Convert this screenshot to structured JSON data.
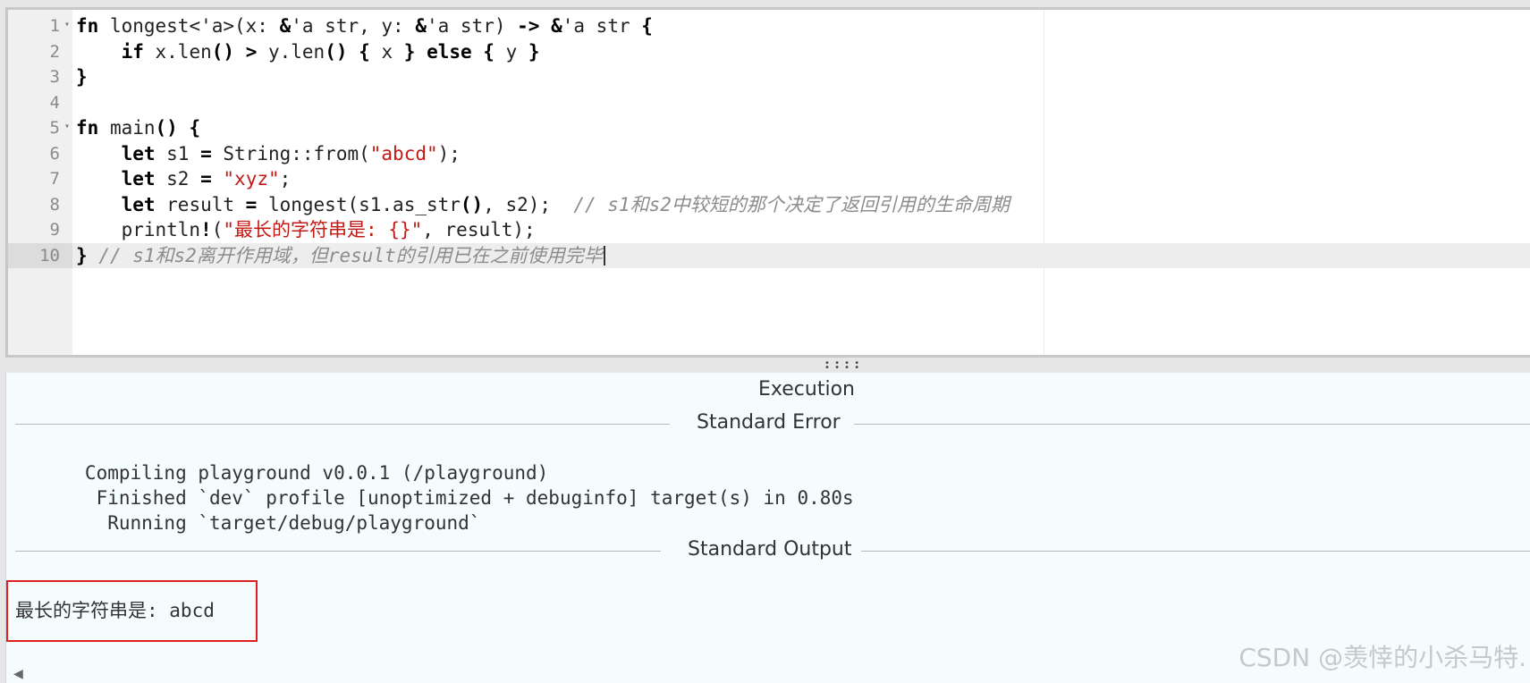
{
  "editor": {
    "lines": [
      {
        "num": "1",
        "fold": "▾",
        "tokens": [
          {
            "t": "fn",
            "c": "k"
          },
          {
            "t": " longest<'a>(x: "
          },
          {
            "t": "&",
            "c": "k"
          },
          {
            "t": "'a str, y: "
          },
          {
            "t": "&",
            "c": "k"
          },
          {
            "t": "'a str) "
          },
          {
            "t": "->",
            "c": "k"
          },
          {
            "t": " "
          },
          {
            "t": "&",
            "c": "k"
          },
          {
            "t": "'a str "
          },
          {
            "t": "{",
            "c": "k"
          }
        ]
      },
      {
        "num": "2",
        "fold": "",
        "tokens": [
          {
            "t": "    "
          },
          {
            "t": "if",
            "c": "k"
          },
          {
            "t": " x.len"
          },
          {
            "t": "()",
            "c": "k"
          },
          {
            "t": " "
          },
          {
            "t": ">",
            "c": "k"
          },
          {
            "t": " y.len"
          },
          {
            "t": "()",
            "c": "k"
          },
          {
            "t": " "
          },
          {
            "t": "{",
            "c": "k"
          },
          {
            "t": " x "
          },
          {
            "t": "}",
            "c": "k"
          },
          {
            "t": " "
          },
          {
            "t": "else",
            "c": "k"
          },
          {
            "t": " "
          },
          {
            "t": "{",
            "c": "k"
          },
          {
            "t": " y "
          },
          {
            "t": "}",
            "c": "k"
          }
        ]
      },
      {
        "num": "3",
        "fold": "",
        "tokens": [
          {
            "t": "}",
            "c": "k"
          }
        ]
      },
      {
        "num": "4",
        "fold": "",
        "tokens": []
      },
      {
        "num": "5",
        "fold": "▾",
        "tokens": [
          {
            "t": "fn",
            "c": "k"
          },
          {
            "t": " main"
          },
          {
            "t": "()",
            "c": "k"
          },
          {
            "t": " "
          },
          {
            "t": "{",
            "c": "k"
          }
        ]
      },
      {
        "num": "6",
        "fold": "",
        "tokens": [
          {
            "t": "    "
          },
          {
            "t": "let",
            "c": "k"
          },
          {
            "t": " s1 "
          },
          {
            "t": "=",
            "c": "k"
          },
          {
            "t": " String::from("
          },
          {
            "t": "\"abcd\"",
            "c": "s"
          },
          {
            "t": ");"
          }
        ]
      },
      {
        "num": "7",
        "fold": "",
        "tokens": [
          {
            "t": "    "
          },
          {
            "t": "let",
            "c": "k"
          },
          {
            "t": " s2 "
          },
          {
            "t": "=",
            "c": "k"
          },
          {
            "t": " "
          },
          {
            "t": "\"xyz\"",
            "c": "s"
          },
          {
            "t": ";"
          }
        ]
      },
      {
        "num": "8",
        "fold": "",
        "tokens": [
          {
            "t": "    "
          },
          {
            "t": "let",
            "c": "k"
          },
          {
            "t": " result "
          },
          {
            "t": "=",
            "c": "k"
          },
          {
            "t": " longest(s1.as_str"
          },
          {
            "t": "()",
            "c": "k"
          },
          {
            "t": ", s2);  "
          },
          {
            "t": "// s1和s2中较短的那个决定了返回引用的生命周期",
            "c": "c"
          }
        ]
      },
      {
        "num": "9",
        "fold": "",
        "tokens": [
          {
            "t": "    println"
          },
          {
            "t": "!",
            "c": "k"
          },
          {
            "t": "("
          },
          {
            "t": "\"最长的字符串是: {}\"",
            "c": "s"
          },
          {
            "t": ", result);"
          }
        ]
      },
      {
        "num": "10",
        "fold": "",
        "active": true,
        "cursor": true,
        "tokens": [
          {
            "t": "}",
            "c": "k"
          },
          {
            "t": " "
          },
          {
            "t": "// s1和s2离开作用域，但result的引用已在之前使用完毕",
            "c": "c"
          }
        ]
      }
    ]
  },
  "output": {
    "title": "Execution",
    "stderr_label": "Standard Error",
    "stderr_lines": "   Compiling playground v0.0.1 (/playground)\n    Finished `dev` profile [unoptimized + debuginfo] target(s) in 0.80s\n     Running `target/debug/playground`",
    "stdout_label": "Standard Output",
    "stdout_text": "最长的字符串是: abcd"
  },
  "watermark": "CSDN @羡悻的小杀马特."
}
